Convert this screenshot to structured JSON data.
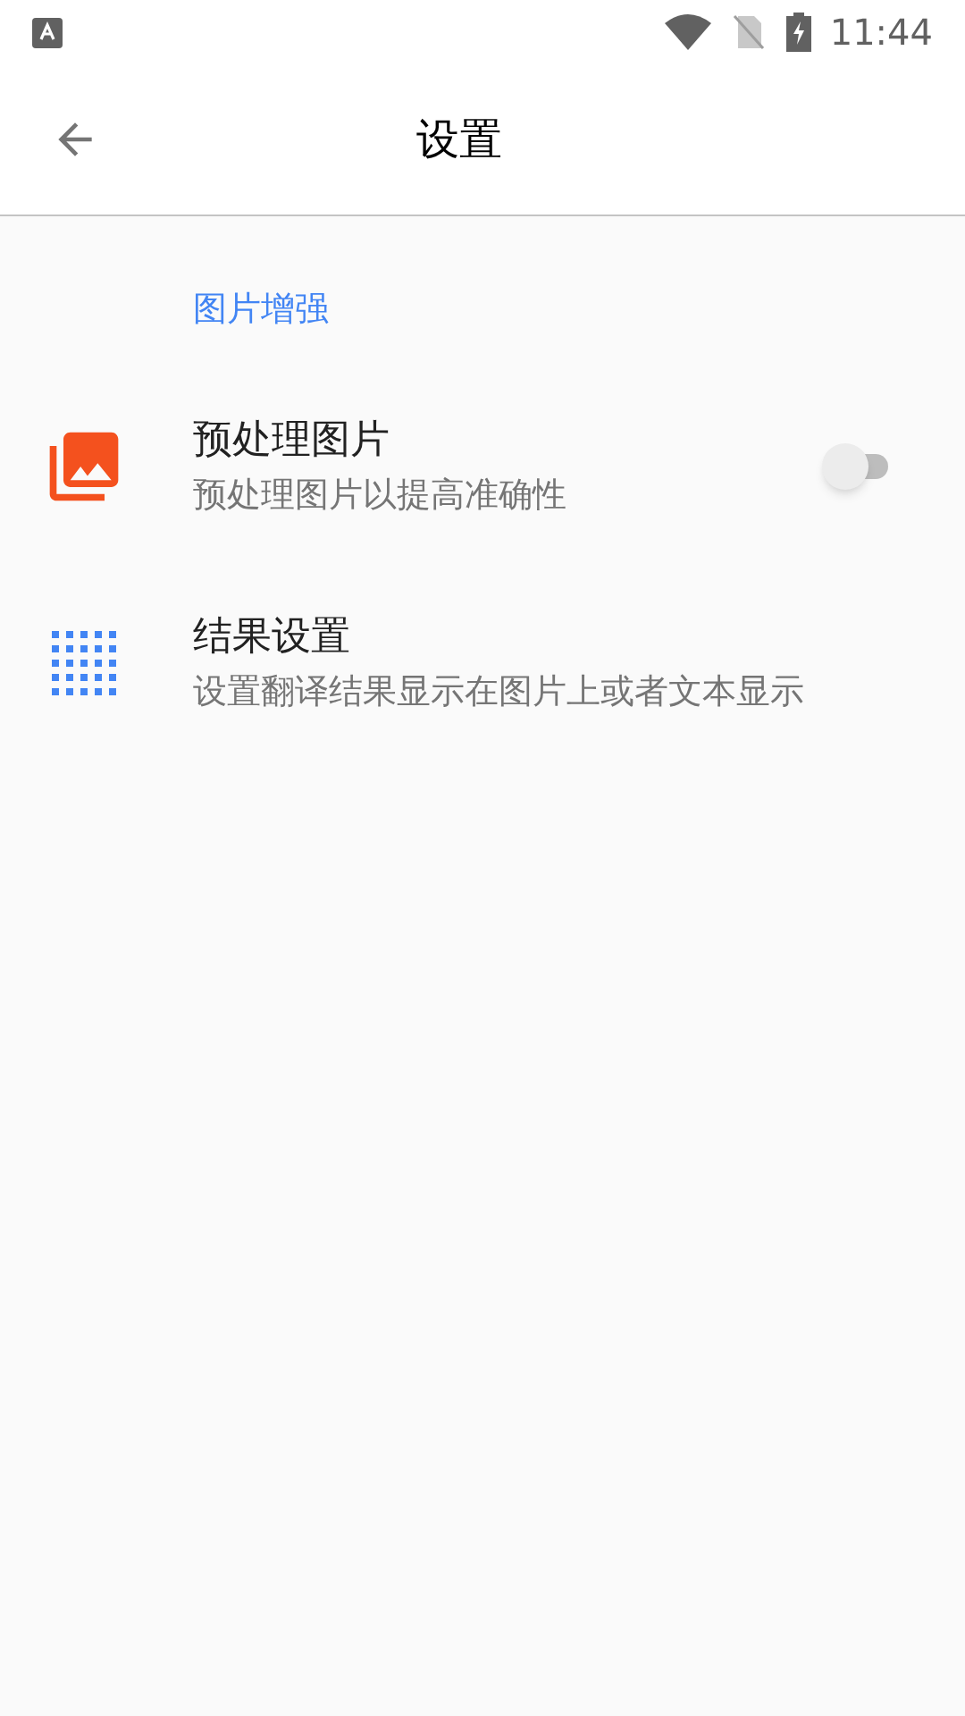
{
  "status_bar": {
    "time": "11:44"
  },
  "app_bar": {
    "title": "设置"
  },
  "section": {
    "title": "图片增强"
  },
  "items": [
    {
      "kind": "switch",
      "title": "预处理图片",
      "subtitle": "预处理图片以提高准确性",
      "on": false
    },
    {
      "kind": "link",
      "title": "结果设置",
      "subtitle": "设置翻译结果显示在图片上或者文本显示"
    }
  ]
}
